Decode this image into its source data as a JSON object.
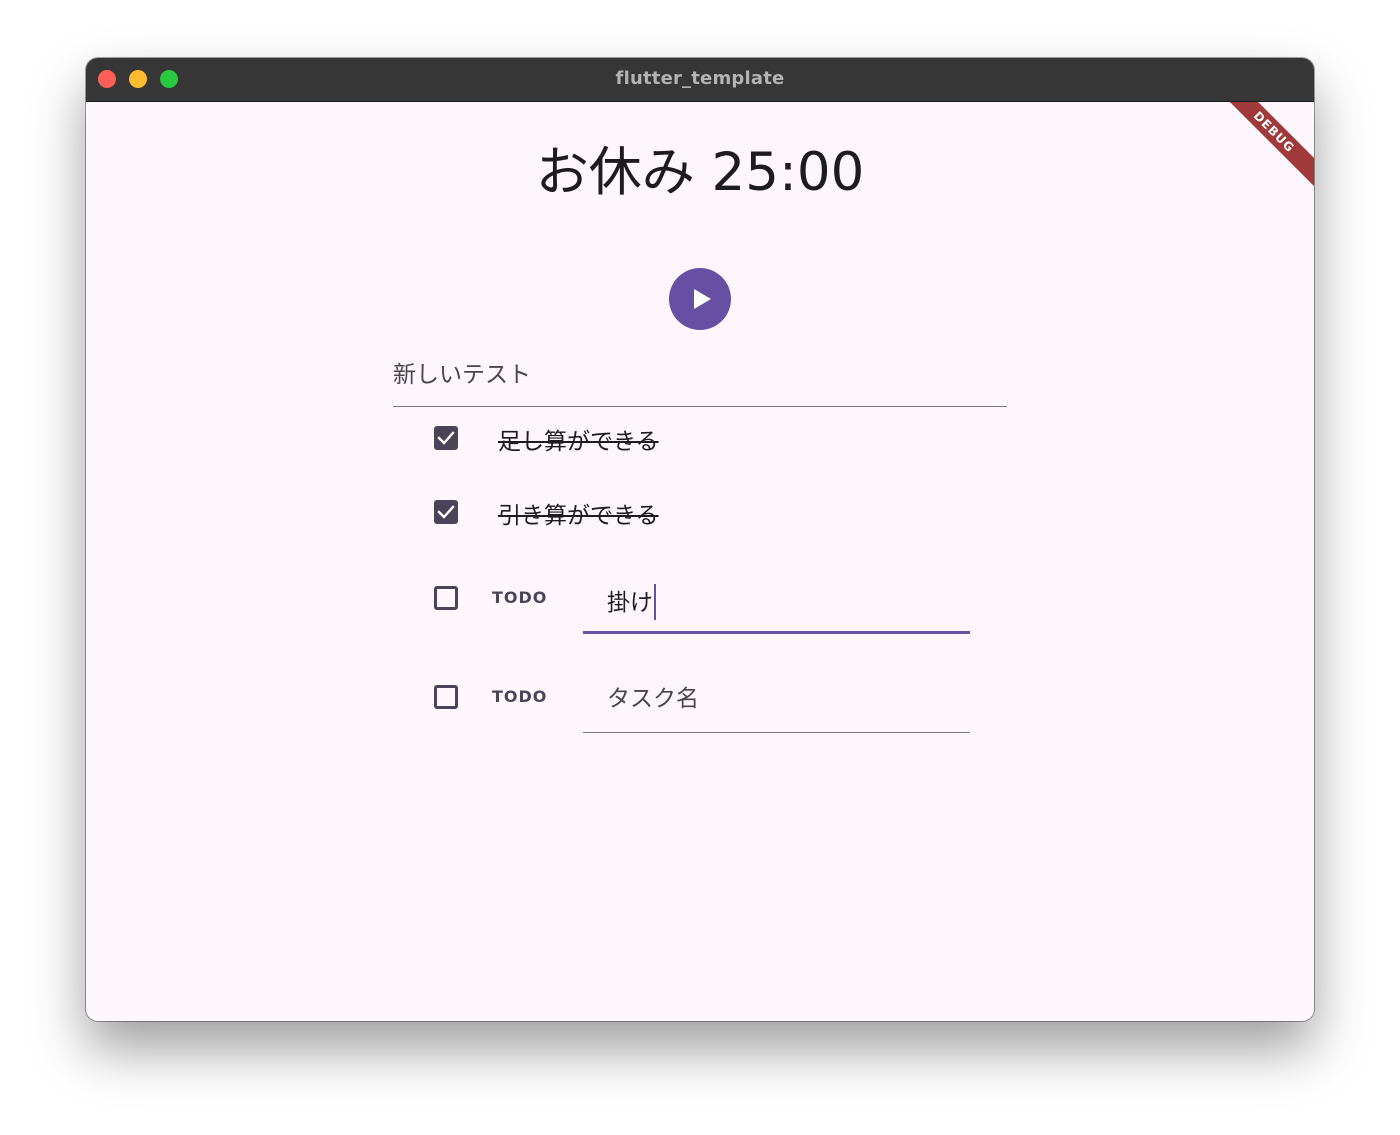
{
  "window": {
    "title": "flutter_template",
    "debug_banner": "DEBUG"
  },
  "timer": {
    "title": "お休み 25:00",
    "play_icon": "play-icon"
  },
  "new_test": {
    "value": "新しいテスト"
  },
  "tasks": [
    {
      "label": "足し算ができる",
      "checked": true
    },
    {
      "label": "引き算ができる",
      "checked": true
    },
    {
      "todo_label": "TODO",
      "value": "掛け",
      "placeholder": "",
      "checked": false,
      "focused": true
    },
    {
      "todo_label": "TODO",
      "value": "",
      "placeholder": "タスク名",
      "checked": false,
      "focused": false
    }
  ],
  "colors": {
    "primary": "#6750a4",
    "background": "#fdf7fd",
    "checkbox": "#4a4458",
    "titlebar": "#363636"
  }
}
